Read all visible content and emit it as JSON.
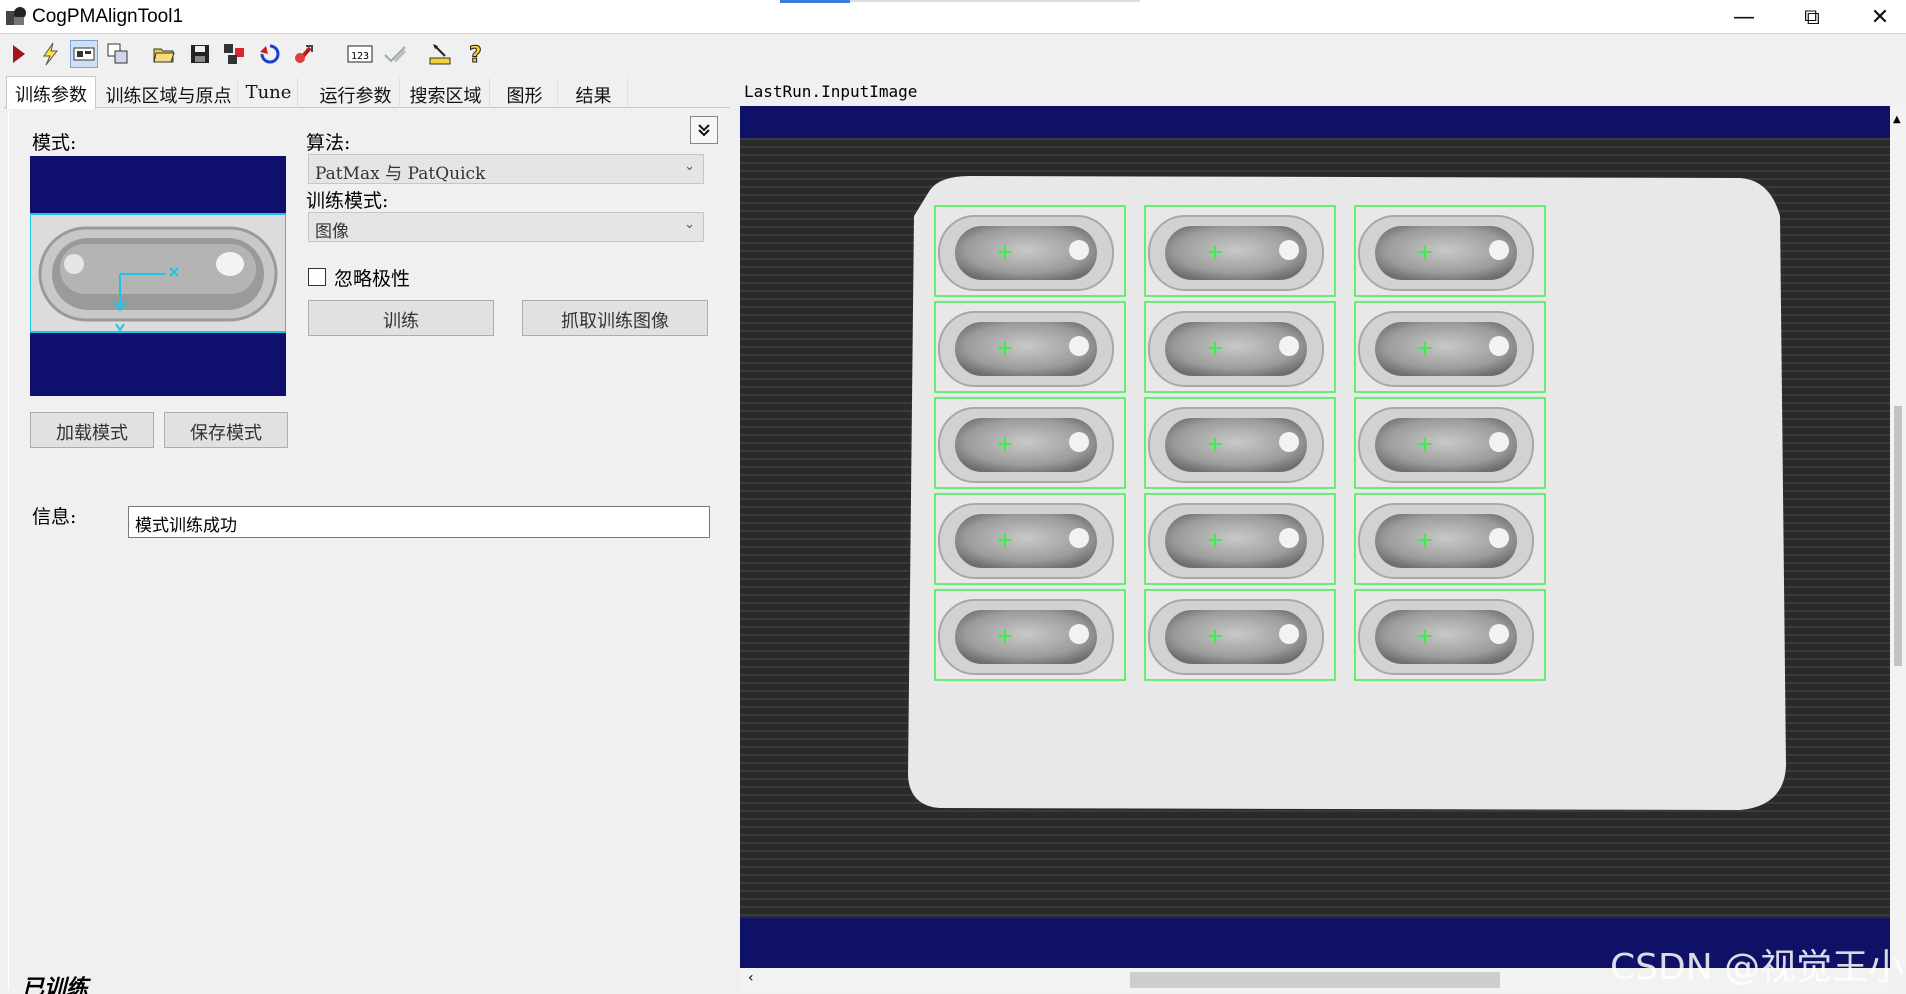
{
  "window": {
    "title": "CogPMAlignTool1",
    "controls": {
      "minimize": "—",
      "restore": "⧉",
      "close": "✕"
    }
  },
  "toolbar": {
    "icons": [
      "run-icon",
      "electric-icon",
      "show-image-icon",
      "copy-icon",
      "open-icon",
      "save-icon",
      "image-source-icon",
      "reset-icon",
      "reset-stats-icon",
      "numeric-display-icon",
      "edit-check-icon",
      "measure-icon",
      "help-icon"
    ]
  },
  "tabs": [
    {
      "label": "训练参数",
      "active": true
    },
    {
      "label": "训练区域与原点"
    },
    {
      "label": "Tune"
    },
    {
      "label": "运行参数"
    },
    {
      "label": "搜索区域"
    },
    {
      "label": "图形"
    },
    {
      "label": "结果"
    }
  ],
  "train_params": {
    "pattern_label": "模式:",
    "algorithm_label": "算法:",
    "algorithm_value": "PatMax 与 PatQuick",
    "train_mode_label": "训练模式:",
    "train_mode_value": "图像",
    "ignore_polarity_label": "忽略极性",
    "ignore_polarity_checked": false,
    "train_button": "训练",
    "grab_image_button": "抓取训练图像",
    "load_pattern_button": "加载模式",
    "save_pattern_button": "保存模式",
    "info_label": "信息:",
    "info_value": "模式训练成功",
    "status": "已训练"
  },
  "display": {
    "title": "LastRun.InputImage",
    "watermark": "CSDN @视觉王小",
    "overlay_color": "#3cf04a",
    "background_color": "#0e1166",
    "capsule_count": 15
  }
}
